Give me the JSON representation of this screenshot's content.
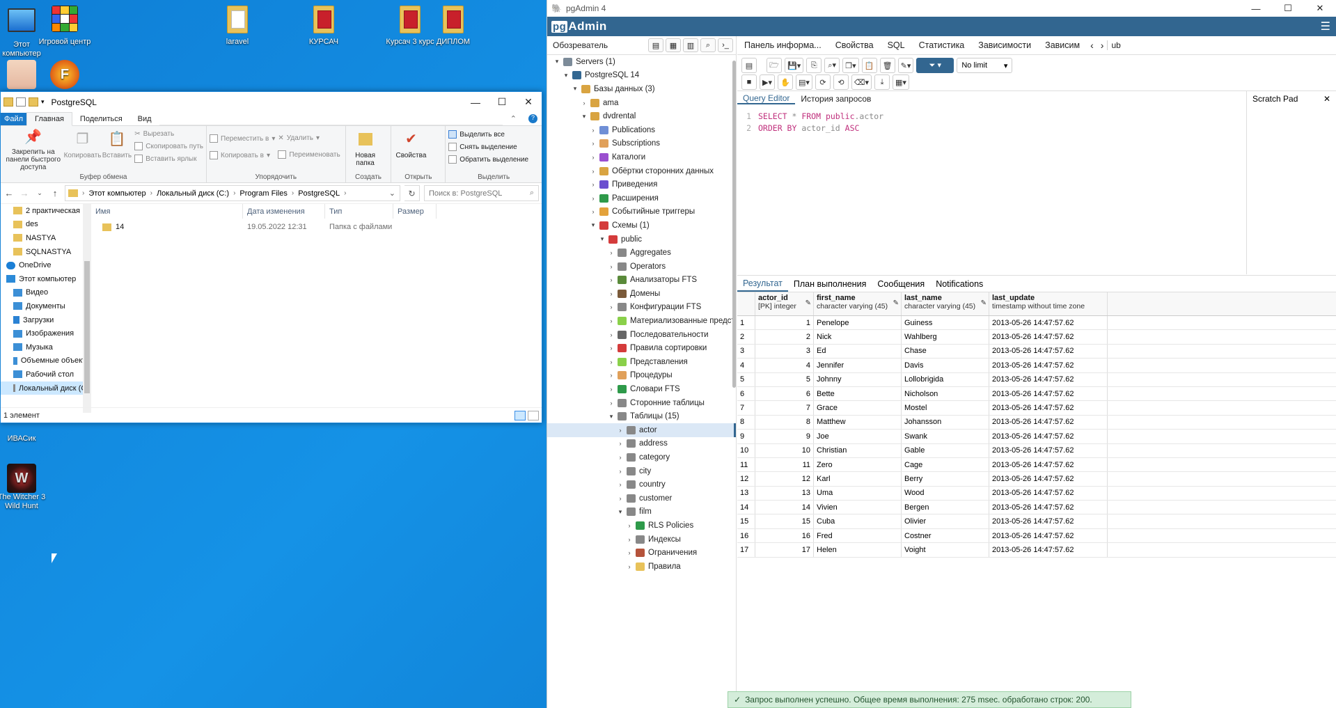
{
  "desktop": {
    "icons": [
      {
        "label": "Этот компьютер"
      },
      {
        "label": "Игровой центр"
      },
      {
        "label": "laravel"
      },
      {
        "label": "КУРСАЧ"
      },
      {
        "label": "Курсач 3 курс"
      },
      {
        "label": "ДИПЛОМ"
      },
      {
        "label": "ИВАСик"
      },
      {
        "label": "The Witcher 3 Wild Hunt"
      }
    ]
  },
  "explorer": {
    "title": "PostgreSQL",
    "tabs": [
      "Файл",
      "Главная",
      "Поделиться",
      "Вид"
    ],
    "ribbon": {
      "clipboard": {
        "group": "Буфер обмена",
        "pin": "Закрепить на панели быстрого доступа",
        "copy": "Копировать",
        "paste": "Вставить",
        "cut": "Вырезать",
        "copy_path": "Скопировать путь",
        "paste_shortcut": "Вставить ярлык"
      },
      "organize": {
        "group": "Упорядочить",
        "move": "Переместить в",
        "copy_to": "Копировать в",
        "delete": "Удалить",
        "rename": "Переименовать"
      },
      "create": {
        "group": "Создать",
        "new_folder": "Новая папка"
      },
      "open": {
        "group": "Открыть",
        "properties": "Свойства"
      },
      "select": {
        "group": "Выделить",
        "select_all": "Выделить все",
        "select_none": "Снять выделение",
        "invert": "Обратить выделение"
      }
    },
    "address": [
      "Этот компьютер",
      "Локальный диск (C:)",
      "Program Files",
      "PostgreSQL"
    ],
    "search_placeholder": "Поиск в: PostgreSQL",
    "nav": [
      {
        "label": "2 практическая",
        "icon": "folder-icon"
      },
      {
        "label": "des",
        "icon": "folder-icon"
      },
      {
        "label": "NASTYA",
        "icon": "folder-icon"
      },
      {
        "label": "SQLNASTYA",
        "icon": "folder-icon"
      },
      {
        "label": "OneDrive",
        "icon": "cloud-icon"
      },
      {
        "label": "Этот компьютер",
        "icon": "computer-icon"
      },
      {
        "label": "Видео",
        "icon": "video-icon"
      },
      {
        "label": "Документы",
        "icon": "documents-icon"
      },
      {
        "label": "Загрузки",
        "icon": "download-icon"
      },
      {
        "label": "Изображения",
        "icon": "pictures-icon"
      },
      {
        "label": "Музыка",
        "icon": "music-icon"
      },
      {
        "label": "Объемные объекты",
        "icon": "3d-icon"
      },
      {
        "label": "Рабочий стол",
        "icon": "desktop-icon"
      },
      {
        "label": "Локальный диск (C:)",
        "icon": "drive-icon"
      }
    ],
    "columns": [
      "Имя",
      "Дата изменения",
      "Тип",
      "Размер"
    ],
    "files": [
      {
        "name": "14",
        "modified": "19.05.2022 12:31",
        "type": "Папка с файлами",
        "size": ""
      }
    ],
    "status": "1 элемент"
  },
  "pgadmin": {
    "title": "pgAdmin 4",
    "logo_pg": "pg",
    "logo_admin": "Admin",
    "browser_title": "Обозреватель",
    "tree": [
      {
        "label": "Servers (1)",
        "level": 0,
        "toggle": "v",
        "color": "#7c8b99"
      },
      {
        "label": "PostgreSQL 14",
        "level": 1,
        "toggle": "v",
        "color": "#336791"
      },
      {
        "label": "Базы данных (3)",
        "level": 2,
        "toggle": "v",
        "color": "#d9a441"
      },
      {
        "label": "ama",
        "level": 3,
        "toggle": ">",
        "color": "#d9a441"
      },
      {
        "label": "dvdrental",
        "level": 3,
        "toggle": "v",
        "color": "#d9a441"
      },
      {
        "label": "Publications",
        "level": 4,
        "toggle": ">",
        "color": "#6f8fd6"
      },
      {
        "label": "Subscriptions",
        "level": 4,
        "toggle": ">",
        "color": "#e0a05a"
      },
      {
        "label": "Каталоги",
        "level": 4,
        "toggle": ">",
        "color": "#9a4fcf"
      },
      {
        "label": "Обёртки сторонних данных",
        "level": 4,
        "toggle": ">",
        "color": "#d9a441"
      },
      {
        "label": "Приведения",
        "level": 4,
        "toggle": ">",
        "color": "#6a4fcf"
      },
      {
        "label": "Расширения",
        "level": 4,
        "toggle": ">",
        "color": "#2e9a4a"
      },
      {
        "label": "Событийные триггеры",
        "level": 4,
        "toggle": ">",
        "color": "#e3a23b"
      },
      {
        "label": "Схемы (1)",
        "level": 4,
        "toggle": "v",
        "color": "#d43b3b"
      },
      {
        "label": "public",
        "level": 5,
        "toggle": "v",
        "color": "#d43b3b"
      },
      {
        "label": "Aggregates",
        "level": 6,
        "toggle": ">",
        "color": "#888"
      },
      {
        "label": "Operators",
        "level": 6,
        "toggle": ">",
        "color": "#888"
      },
      {
        "label": "Анализаторы FTS",
        "level": 6,
        "toggle": ">",
        "color": "#5a8a3a"
      },
      {
        "label": "Домены",
        "level": 6,
        "toggle": ">",
        "color": "#7a5a3a"
      },
      {
        "label": "Конфигурации FTS",
        "level": 6,
        "toggle": ">",
        "color": "#888"
      },
      {
        "label": "Материализованные предст",
        "level": 6,
        "toggle": ">",
        "color": "#8ad04a"
      },
      {
        "label": "Последовательности",
        "level": 6,
        "toggle": ">",
        "color": "#666"
      },
      {
        "label": "Правила сортировки",
        "level": 6,
        "toggle": ">",
        "color": "#d43b3b"
      },
      {
        "label": "Представления",
        "level": 6,
        "toggle": ">",
        "color": "#8ad04a"
      },
      {
        "label": "Процедуры",
        "level": 6,
        "toggle": ">",
        "color": "#e0a05a"
      },
      {
        "label": "Словари FTS",
        "level": 6,
        "toggle": ">",
        "color": "#2e9a4a"
      },
      {
        "label": "Сторонние таблицы",
        "level": 6,
        "toggle": ">",
        "color": "#888"
      },
      {
        "label": "Таблицы (15)",
        "level": 6,
        "toggle": "v",
        "color": "#888"
      },
      {
        "label": "actor",
        "level": 7,
        "toggle": ">",
        "color": "#888",
        "selected": true
      },
      {
        "label": "address",
        "level": 7,
        "toggle": ">",
        "color": "#888"
      },
      {
        "label": "category",
        "level": 7,
        "toggle": ">",
        "color": "#888"
      },
      {
        "label": "city",
        "level": 7,
        "toggle": ">",
        "color": "#888"
      },
      {
        "label": "country",
        "level": 7,
        "toggle": ">",
        "color": "#888"
      },
      {
        "label": "customer",
        "level": 7,
        "toggle": ">",
        "color": "#888"
      },
      {
        "label": "film",
        "level": 7,
        "toggle": "v",
        "color": "#888"
      },
      {
        "label": "RLS Policies",
        "level": 8,
        "toggle": ">",
        "color": "#2e9a4a"
      },
      {
        "label": "Индексы",
        "level": 8,
        "toggle": ">",
        "color": "#888"
      },
      {
        "label": "Ограничения",
        "level": 8,
        "toggle": ">",
        "color": "#b5533b"
      },
      {
        "label": "Правила",
        "level": 8,
        "toggle": ">",
        "color": "#e8c25a"
      }
    ],
    "main_tabs": [
      "Панель информа...",
      "Свойства",
      "SQL",
      "Статистика",
      "Зависимости",
      "Зависим"
    ],
    "main_tab_overflow": "ub",
    "limit": "No limit",
    "editor_tabs": [
      "Query Editor",
      "История запросов"
    ],
    "scratch_title": "Scratch Pad",
    "code": [
      [
        {
          "t": "SELECT",
          "c": "kw"
        },
        {
          "t": " * ",
          "c": "id"
        },
        {
          "t": "FROM",
          "c": "kw"
        },
        {
          "t": " public",
          "c": "kw"
        },
        {
          "t": ".actor",
          "c": "id"
        }
      ],
      [
        {
          "t": "ORDER BY",
          "c": "kw"
        },
        {
          "t": " actor_id ",
          "c": "id"
        },
        {
          "t": "ASC",
          "c": "kw"
        }
      ]
    ],
    "result_tabs": [
      "Результат",
      "План выполнения",
      "Сообщения",
      "Notifications"
    ],
    "columns": [
      {
        "name": "actor_id",
        "type": "[PK] integer"
      },
      {
        "name": "first_name",
        "type": "character varying (45)"
      },
      {
        "name": "last_name",
        "type": "character varying (45)"
      },
      {
        "name": "last_update",
        "type": "timestamp without time zone"
      }
    ],
    "rows": [
      [
        "1",
        "1",
        "Penelope",
        "Guiness",
        "2013-05-26 14:47:57.62"
      ],
      [
        "2",
        "2",
        "Nick",
        "Wahlberg",
        "2013-05-26 14:47:57.62"
      ],
      [
        "3",
        "3",
        "Ed",
        "Chase",
        "2013-05-26 14:47:57.62"
      ],
      [
        "4",
        "4",
        "Jennifer",
        "Davis",
        "2013-05-26 14:47:57.62"
      ],
      [
        "5",
        "5",
        "Johnny",
        "Lollobrigida",
        "2013-05-26 14:47:57.62"
      ],
      [
        "6",
        "6",
        "Bette",
        "Nicholson",
        "2013-05-26 14:47:57.62"
      ],
      [
        "7",
        "7",
        "Grace",
        "Mostel",
        "2013-05-26 14:47:57.62"
      ],
      [
        "8",
        "8",
        "Matthew",
        "Johansson",
        "2013-05-26 14:47:57.62"
      ],
      [
        "9",
        "9",
        "Joe",
        "Swank",
        "2013-05-26 14:47:57.62"
      ],
      [
        "10",
        "10",
        "Christian",
        "Gable",
        "2013-05-26 14:47:57.62"
      ],
      [
        "11",
        "11",
        "Zero",
        "Cage",
        "2013-05-26 14:47:57.62"
      ],
      [
        "12",
        "12",
        "Karl",
        "Berry",
        "2013-05-26 14:47:57.62"
      ],
      [
        "13",
        "13",
        "Uma",
        "Wood",
        "2013-05-26 14:47:57.62"
      ],
      [
        "14",
        "14",
        "Vivien",
        "Bergen",
        "2013-05-26 14:47:57.62"
      ],
      [
        "15",
        "15",
        "Cuba",
        "Olivier",
        "2013-05-26 14:47:57.62"
      ],
      [
        "16",
        "16",
        "Fred",
        "Costner",
        "2013-05-26 14:47:57.62"
      ],
      [
        "17",
        "17",
        "Helen",
        "Voight",
        "2013-05-26 14:47:57.62"
      ]
    ],
    "toast": "Запрос выполнен успешно. Общее время выполнения: 275 msec. обработано строк: 200."
  }
}
